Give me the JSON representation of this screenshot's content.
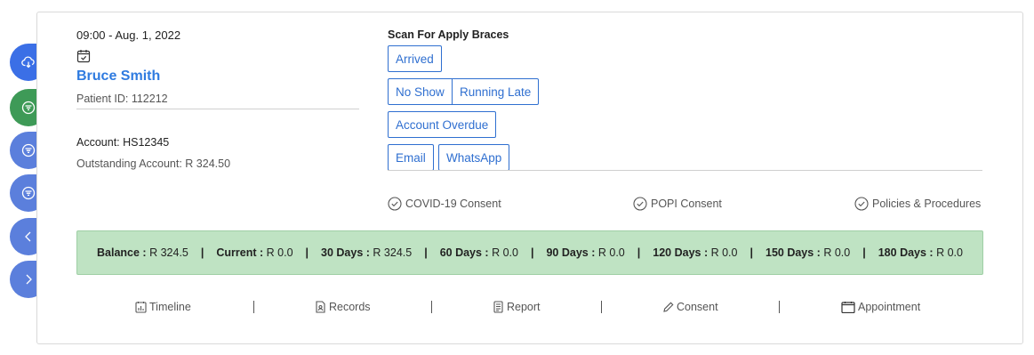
{
  "sidebar": {
    "buttons": [
      {
        "icon": "cloud-download-icon",
        "color": "#3b6fe6"
      },
      {
        "icon": "filter-icon",
        "color": "#3e9a57"
      },
      {
        "icon": "filter-icon",
        "color": "#5b7fdc"
      },
      {
        "icon": "filter-icon",
        "color": "#5b7fdc"
      },
      {
        "icon": "chevron-left-icon",
        "color": "#5b7fdc"
      },
      {
        "icon": "chevron-right-icon",
        "color": "#5b7fdc"
      }
    ]
  },
  "appointment": {
    "time": "09:00 - Aug. 1, 2022",
    "patient_name": "Bruce Smith",
    "patient_id": "Patient ID: 112212",
    "account": "Account: HS12345",
    "outstanding": "Outstanding Account: R 324.50"
  },
  "scan": {
    "title": "Scan For Apply Braces",
    "arrived": "Arrived",
    "no_show": "No Show",
    "running_late": "Running Late",
    "account_overdue": "Account Overdue",
    "email": "Email",
    "whatsapp": "WhatsApp"
  },
  "consents": {
    "covid": "COVID-19 Consent",
    "popi": "POPI Consent",
    "policies": "Policies & Procedures"
  },
  "balance": {
    "balance_label": "Balance :",
    "balance_value": "R 324.5",
    "current_label": "Current :",
    "current_value": "R 0.0",
    "d30_label": "30 Days :",
    "d30_value": "R 324.5",
    "d60_label": "60 Days :",
    "d60_value": "R 0.0",
    "d90_label": "90 Days :",
    "d90_value": "R 0.0",
    "d120_label": "120 Days :",
    "d120_value": "R 0.0",
    "d150_label": "150 Days :",
    "d150_value": "R 0.0",
    "d180_label": "180 Days :",
    "d180_value": "R 0.0",
    "separator": "|"
  },
  "nav": {
    "timeline": "Timeline",
    "records": "Records",
    "report": "Report",
    "consent": "Consent",
    "appointment": "Appointment"
  },
  "colors": {
    "accent": "#2f7be0",
    "balance_bg": "#bfe3c3"
  }
}
